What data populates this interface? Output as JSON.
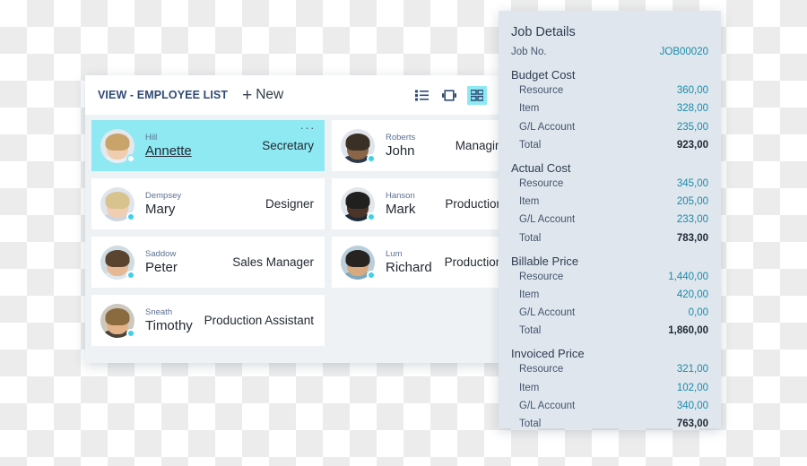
{
  "employee_window": {
    "header": {
      "view_title": "VIEW - EMPLOYEE LIST",
      "new_label": "New",
      "plus_glyph": "+",
      "icons": [
        {
          "name": "list-view-icon",
          "label": "List view",
          "active": false
        },
        {
          "name": "detail-view-icon",
          "label": "Detail view",
          "active": false
        },
        {
          "name": "tile-view-icon",
          "label": "Tile view",
          "active": true
        }
      ]
    },
    "card_menu_glyph": "···",
    "cards": [
      {
        "last_name": "Hill",
        "first_name": "Annette",
        "job_title": "Secretary",
        "selected": true,
        "hair": "#c9a46a",
        "face": "#f0cdb0",
        "body": "#e8eef4",
        "bg": "#e3e8ee"
      },
      {
        "last_name": "Roberts",
        "first_name": "John",
        "job_title": "Managing Director",
        "selected": false,
        "hair": "#3a3026",
        "face": "#8a6547",
        "body": "#2b3a4a",
        "bg": "#dfe5eb"
      },
      {
        "last_name": "Dempsey",
        "first_name": "Mary",
        "job_title": "Designer",
        "selected": false,
        "hair": "#d8c38f",
        "face": "#f1cdb2",
        "body": "#cdd6de",
        "bg": "#dfe5eb"
      },
      {
        "last_name": "Hanson",
        "first_name": "Mark",
        "job_title": "Production Manager",
        "selected": false,
        "hair": "#20201e",
        "face": "#4a3528",
        "body": "#1d2a36",
        "bg": "#e2e7ec"
      },
      {
        "last_name": "Saddow",
        "first_name": "Peter",
        "job_title": "Sales Manager",
        "selected": false,
        "hair": "#5a4430",
        "face": "#e6b893",
        "body": "#dfe7ee",
        "bg": "#cfdde2"
      },
      {
        "last_name": "Lum",
        "first_name": "Richard",
        "job_title": "Production Assistant",
        "selected": false,
        "hair": "#272320",
        "face": "#d8a87e",
        "body": "#7fa8bd",
        "bg": "#b9cfdb"
      },
      {
        "last_name": "Sneath",
        "first_name": "Timothy",
        "job_title": "Production Assistant",
        "selected": false,
        "hair": "#8a6b3f",
        "face": "#e3b289",
        "body": "#4c4338",
        "bg": "#cdc8bd"
      }
    ]
  },
  "job_details": {
    "title": "Job Details",
    "job_no_label": "Job No.",
    "job_no_value": "JOB00020",
    "groups": [
      {
        "name": "Budget Cost",
        "rows": [
          {
            "label": "Resource",
            "value": "360,00",
            "total": false
          },
          {
            "label": "Item",
            "value": "328,00",
            "total": false
          },
          {
            "label": "G/L Account",
            "value": "235,00",
            "total": false
          },
          {
            "label": "Total",
            "value": "923,00",
            "total": true
          }
        ]
      },
      {
        "name": "Actual Cost",
        "rows": [
          {
            "label": "Resource",
            "value": "345,00",
            "total": false
          },
          {
            "label": "Item",
            "value": "205,00",
            "total": false
          },
          {
            "label": "G/L Account",
            "value": "233,00",
            "total": false
          },
          {
            "label": "Total",
            "value": "783,00",
            "total": true
          }
        ]
      },
      {
        "name": "Billable Price",
        "rows": [
          {
            "label": "Resource",
            "value": "1,440,00",
            "total": false
          },
          {
            "label": "Item",
            "value": "420,00",
            "total": false
          },
          {
            "label": "G/L Account",
            "value": "0,00",
            "total": false
          },
          {
            "label": "Total",
            "value": "1,860,00",
            "total": true
          }
        ]
      },
      {
        "name": "Invoiced Price",
        "rows": [
          {
            "label": "Resource",
            "value": "321,00",
            "total": false
          },
          {
            "label": "Item",
            "value": "102,00",
            "total": false
          },
          {
            "label": "G/L Account",
            "value": "340,00",
            "total": false
          },
          {
            "label": "Total",
            "value": "763,00",
            "total": true
          }
        ]
      }
    ]
  },
  "colors": {
    "accent_cyan": "#8fe9f2",
    "panel_blue_gray": "#dfe6ee",
    "value_teal": "#1a8ba8",
    "title_navy": "#2f4a76",
    "window_body": "#eff2f5"
  }
}
